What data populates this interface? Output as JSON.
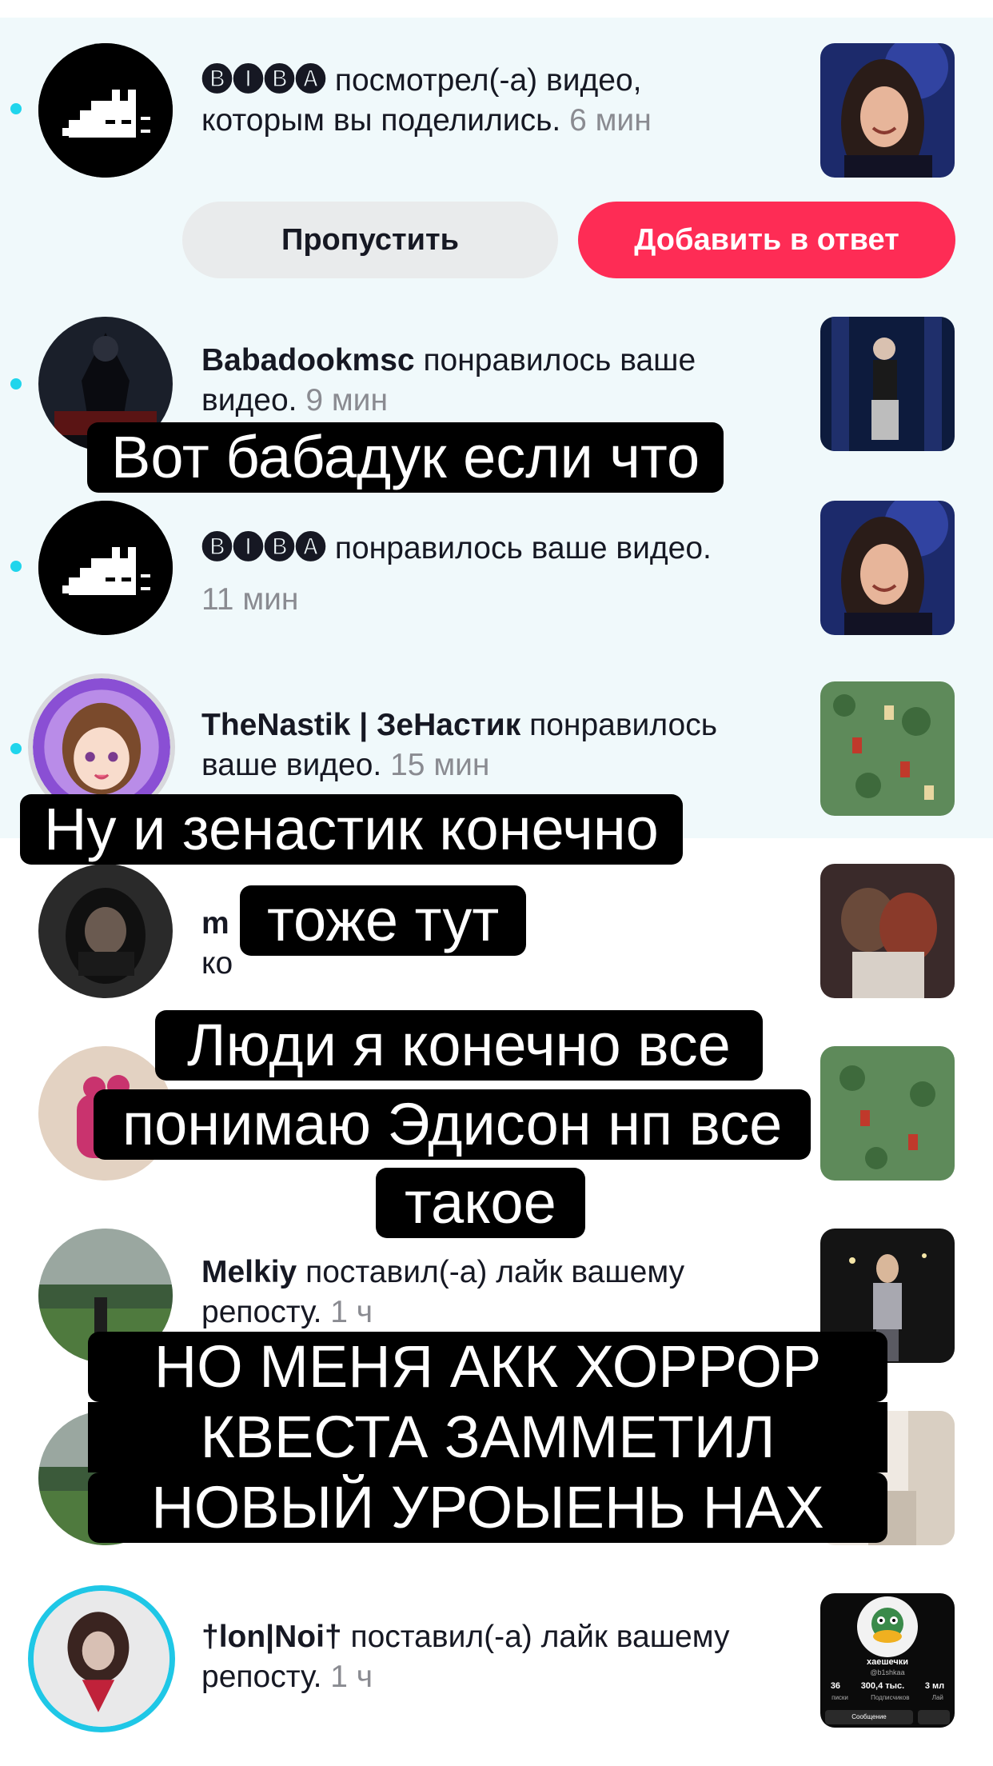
{
  "notifications": [
    {
      "user": "🅑🅘🅑🅐",
      "action": "посмотрел(-а) видео, которым вы поделились.",
      "time": "6 мин",
      "avatar_icon": "pixel-cat-avatar",
      "unread": true
    },
    {
      "user": "Babadookmsc",
      "action": "понравилось ваше видео.",
      "time": "9 мин",
      "avatar_icon": "dark-horror-avatar",
      "unread": true
    },
    {
      "user": "🅑🅘🅑🅐",
      "action": "понравилось ваше видео.",
      "time": "11 мин",
      "avatar_icon": "pixel-cat-avatar",
      "unread": true
    },
    {
      "user": "TheNastik | ЗеНастик",
      "action": "понравилось ваше видео.",
      "time": "15 мин",
      "avatar_icon": "anime-girl-avatar",
      "unread": true
    },
    {
      "user": "m",
      "action": "ко",
      "time": "",
      "avatar_icon": "hooded-person-avatar",
      "unread": false
    },
    {
      "user": "",
      "action": "",
      "time": "",
      "avatar_icon": "pink-figure-avatar",
      "unread": false
    },
    {
      "user": "Melkiy",
      "action": "поставил(-а) лайк вашему репосту.",
      "time": "1 ч",
      "avatar_icon": "field-landscape-avatar",
      "unread": false
    },
    {
      "user": "",
      "action": "",
      "time": "",
      "avatar_icon": "field-landscape-avatar",
      "unread": false
    },
    {
      "user": "†lon|Noi†",
      "action": "поставил(-а) лайк вашему репосту.",
      "time": "1 ч",
      "avatar_icon": "red-figure-avatar",
      "unread": false
    }
  ],
  "buttons": {
    "skip": "Пропустить",
    "add_to_reply": "Добавить в ответ"
  },
  "profile_thumb": {
    "name": "хаешечки",
    "handle": "@b1shkaa",
    "stat_1": "36",
    "stat_1_label": "писки",
    "stat_2": "300,4 тыс.",
    "stat_2_label": "Подписчиков",
    "stat_3": "3 мл",
    "stat_3_label": "Лай",
    "message": "Сообщение"
  },
  "captions": {
    "c1": "Вот бабадук если что",
    "c2": "Ну и зенастик конечно",
    "c3": "тоже тут",
    "c4_line1": "Люди я конечно все",
    "c4_line2": "понимаю Эдисон нп все",
    "c4_line3": "такое",
    "c5_line1": "НО МЕНЯ АКК ХОРРОР",
    "c5_line2": "КВЕСТА ЗАММЕТИЛ",
    "c5_line3": "НОВЫЙ УРОЫЕНЬ НАХ"
  },
  "colors": {
    "accent": "#fe2c55",
    "unread_dot": "#20d5ec",
    "unread_background": "#f0f9fb",
    "secondary_text": "#8a8b91"
  }
}
